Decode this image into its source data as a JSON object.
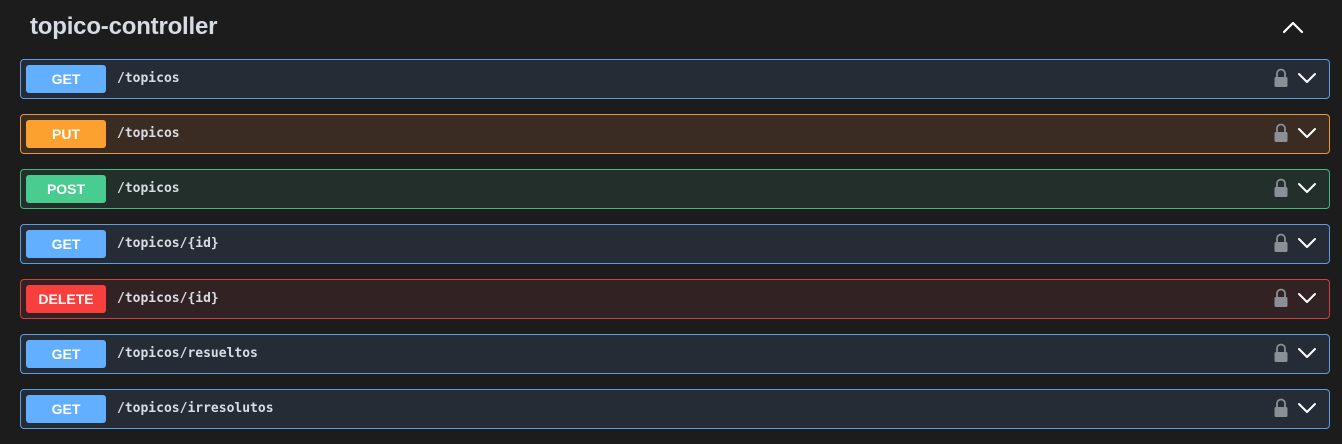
{
  "section": {
    "title": "topico-controller",
    "expanded": true
  },
  "colors": {
    "GET": "#61affe",
    "PUT": "#fca130",
    "POST": "#49cc90",
    "DELETE": "#f93e3e"
  },
  "operations": [
    {
      "method": "GET",
      "path": "/topicos",
      "lock_icon": "lock-icon",
      "toggle_icon": "chevron-down-icon"
    },
    {
      "method": "PUT",
      "path": "/topicos",
      "lock_icon": "lock-icon",
      "toggle_icon": "chevron-down-icon"
    },
    {
      "method": "POST",
      "path": "/topicos",
      "lock_icon": "lock-icon",
      "toggle_icon": "chevron-down-icon"
    },
    {
      "method": "GET",
      "path": "/topicos/{id}",
      "lock_icon": "lock-icon",
      "toggle_icon": "chevron-down-icon"
    },
    {
      "method": "DELETE",
      "path": "/topicos/{id}",
      "lock_icon": "lock-icon",
      "toggle_icon": "chevron-down-icon"
    },
    {
      "method": "GET",
      "path": "/topicos/resueltos",
      "lock_icon": "lock-icon",
      "toggle_icon": "chevron-down-icon"
    },
    {
      "method": "GET",
      "path": "/topicos/irresolutos",
      "lock_icon": "lock-icon",
      "toggle_icon": "chevron-down-icon"
    }
  ]
}
